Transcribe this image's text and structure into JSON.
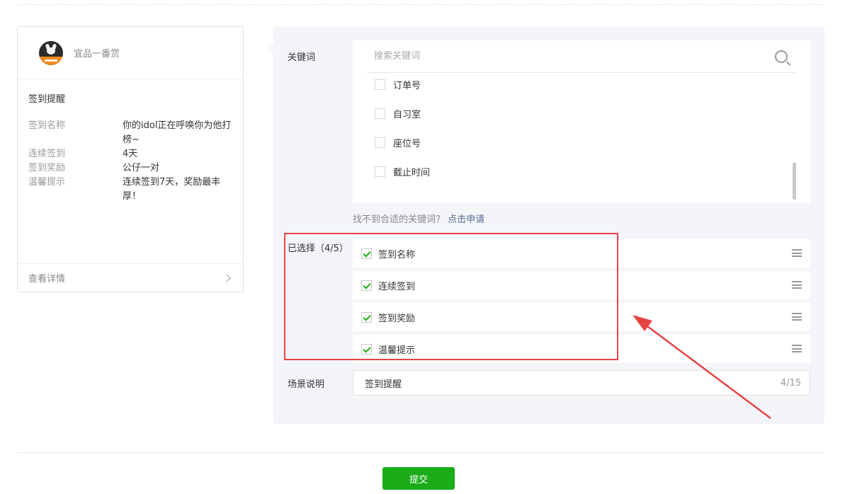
{
  "preview": {
    "brand_name": "宜品一番赏",
    "title": "签到提醒",
    "fields": [
      {
        "key": "签到名称",
        "value": "你的idol正在呼唤你为他打榜~"
      },
      {
        "key": "连续签到",
        "value": "4天"
      },
      {
        "key": "签到奖励",
        "value": "公仔一对"
      },
      {
        "key": "温馨提示",
        "value": "连续签到7天，奖励最丰厚！"
      }
    ],
    "footer_link": "查看详情"
  },
  "config": {
    "keyword_label": "关键词",
    "search_placeholder": "搜索关键词",
    "keyword_options": [
      "订单号",
      "自习室",
      "座位号",
      "截止时间"
    ],
    "hint_text": "找不到合适的关键词？",
    "hint_link": "点击申请",
    "selected_label": "已选择（4/5）",
    "selected_items": [
      "签到名称",
      "连续签到",
      "签到奖励",
      "温馨提示"
    ],
    "scene_label": "场景说明",
    "scene_value": "签到提醒",
    "scene_counter": "4/15"
  },
  "submit_label": "提交",
  "colors": {
    "accent_green": "#1aad19",
    "annotation_red": "#e84343",
    "panel_bg": "#f4f5f9",
    "link_blue": "#576b95"
  },
  "icons": [
    "avatar",
    "search-icon",
    "chevron-right-icon",
    "drag-handle-icon",
    "checkbox-icon",
    "check-icon",
    "arrow-icon"
  ]
}
